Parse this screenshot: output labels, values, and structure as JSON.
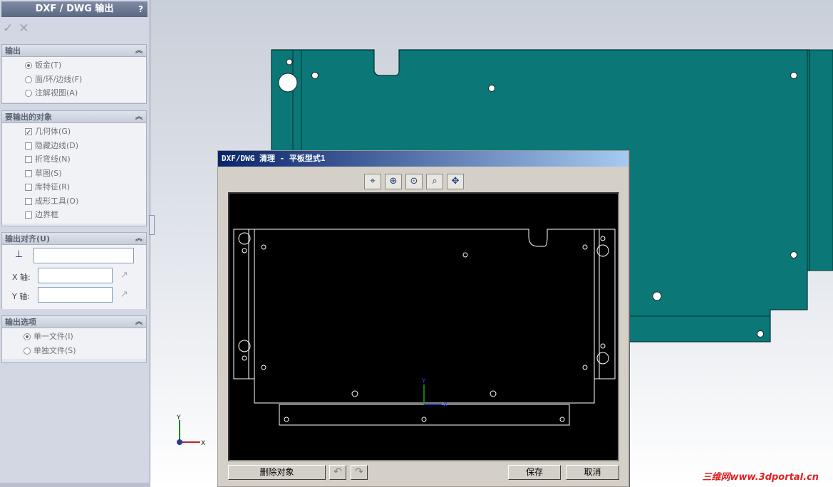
{
  "panel": {
    "title": "DXF / DWG 输出",
    "help": "?",
    "ok_icon": "check-icon",
    "cancel_icon": "x-icon",
    "groups": {
      "output": {
        "header": "输出",
        "items": [
          "钣金(T)",
          "面/环/边线(F)",
          "注解视图(A)"
        ],
        "selected": "钣金(T)"
      },
      "objects": {
        "header": "要输出的对象",
        "items": [
          "几何体(G)",
          "隐藏边线(D)",
          "折弯线(N)",
          "草图(S)",
          "库特征(R)",
          "成形工具(O)",
          "边界框"
        ],
        "checked": [
          "几何体(G)"
        ]
      },
      "align": {
        "header": "输出对齐(U)",
        "x_label": "X 轴:",
        "y_label": "Y 轴:",
        "origin_value": "",
        "x_value": "",
        "y_value": ""
      },
      "options": {
        "header": "输出选项",
        "items": [
          "单一文件(I)",
          "单独文件(S)"
        ],
        "selected": "单一文件(I)"
      }
    }
  },
  "triad": {
    "x": "X",
    "y": "Y"
  },
  "dialog": {
    "title": "DXF/DWG 清理 - 平板型式1",
    "toolbar_icons": [
      "select-wand-icon",
      "zoom-icon",
      "zoom-fit-icon",
      "zoom-area-icon",
      "pan-icon"
    ],
    "preview_axes": {
      "x": "X",
      "y": "Y"
    },
    "delete_label": "删除对象",
    "undo_icon": "undo-icon",
    "redo_icon": "redo-icon",
    "save_label": "保存",
    "cancel_label": "取消"
  },
  "watermark": "三维网www.3dportal.cn"
}
